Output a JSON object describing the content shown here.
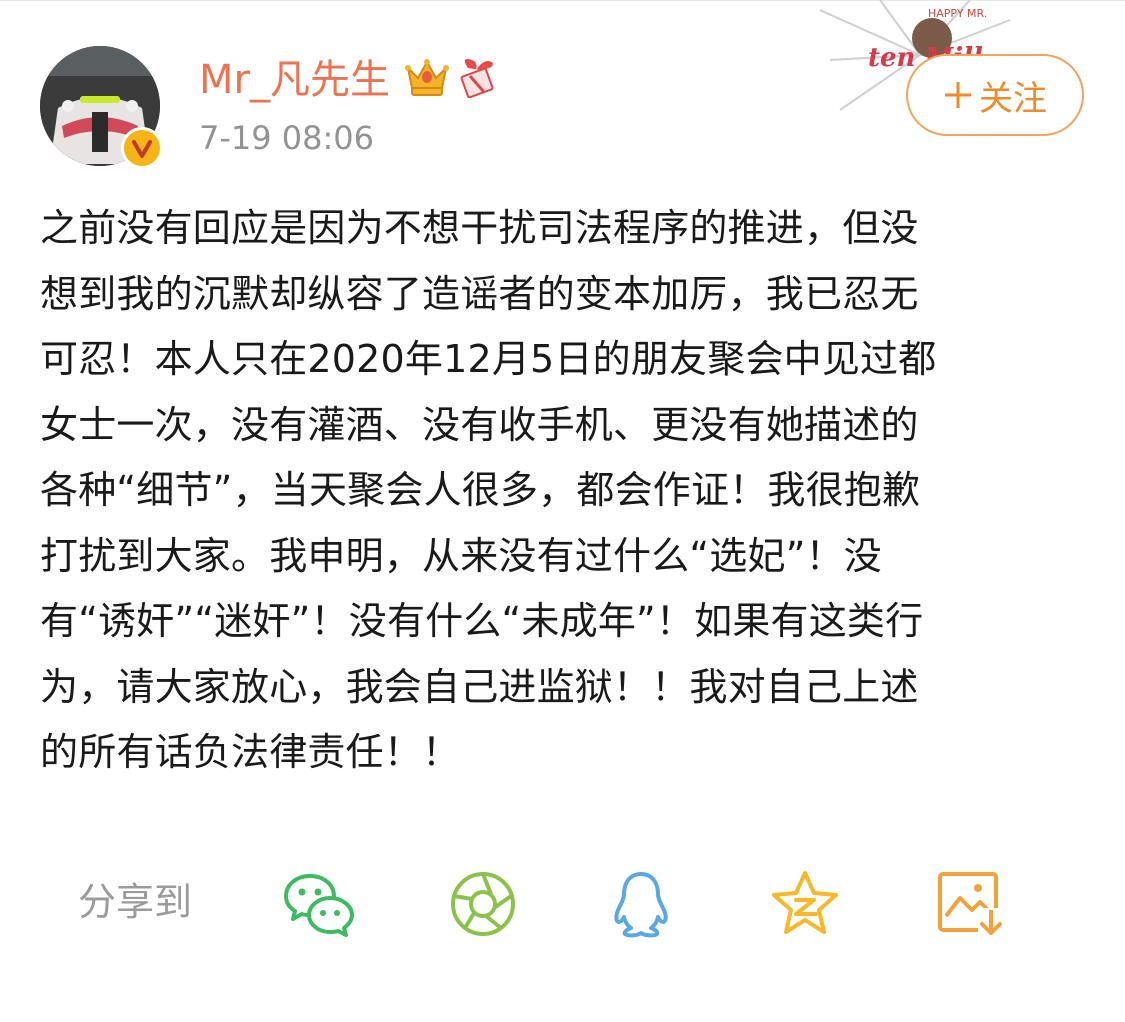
{
  "user": {
    "name": "Mr_凡先生",
    "timestamp": "7-19 08:06",
    "verified_badge": "V",
    "badges": [
      "crown-icon",
      "gift-icon"
    ]
  },
  "follow_button": {
    "label": "关注",
    "icon": "plus-icon"
  },
  "decoration": {
    "text_top": "HAPPY MR.",
    "text_main": "ten Mill"
  },
  "post": {
    "lines": [
      "之前没有回应是因为不想干扰司法程序的推进，但没",
      "想到我的沉默却纵容了造谣者的变本加厉，我已忍无",
      "可忍！本人只在2020年12月5日的朋友聚会中见过都",
      "女士一次，没有灌酒、没有收手机、更没有她描述的",
      "各种“细节”，当天聚会人很多，都会作证！我很抱歉",
      "打扰到大家。我申明，从来没有过什么“选妃”！没",
      "有“诱奸”“迷奸”！没有什么“未成年”！如果有这类行",
      "为，请大家放心，我会自己进监狱！！我对自己上述",
      "的所有话负法律责任！！"
    ]
  },
  "share": {
    "label": "分享到",
    "targets": [
      {
        "name": "wechat-icon",
        "color": "#3dbb63"
      },
      {
        "name": "moments-icon",
        "color": "#8bc34a"
      },
      {
        "name": "qq-icon",
        "color": "#5aa7e6"
      },
      {
        "name": "qzone-icon",
        "color": "#f7b82c"
      },
      {
        "name": "save-image-icon",
        "color": "#f3a23a"
      }
    ]
  },
  "colors": {
    "username": "#eb7350",
    "timestamp": "#939393",
    "follow_border": "#f5a35a",
    "body_text": "#1a1a1a"
  }
}
